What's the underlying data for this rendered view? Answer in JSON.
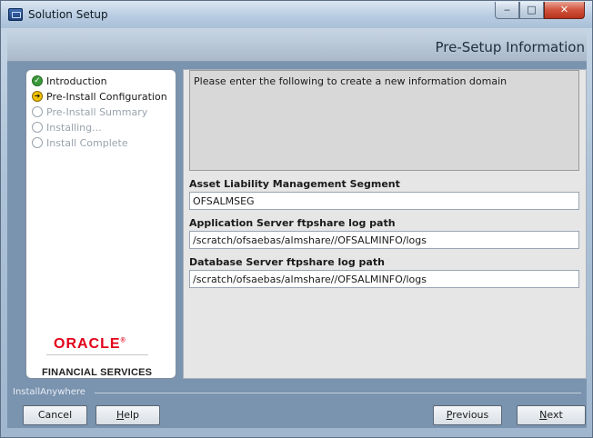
{
  "window": {
    "title": "Solution Setup",
    "minimize_glyph": "‒",
    "maximize_glyph": "□",
    "close_glyph": "✕"
  },
  "header": {
    "title": "Pre-Setup Information"
  },
  "steps": [
    {
      "label": "Introduction",
      "state": "done",
      "icon": "check-icon"
    },
    {
      "label": "Pre-Install Configuration",
      "state": "current",
      "icon": "arrow-right-icon"
    },
    {
      "label": "Pre-Install Summary",
      "state": "pending",
      "icon": "empty-circle-icon"
    },
    {
      "label": "Installing...",
      "state": "pending",
      "icon": "empty-circle-icon"
    },
    {
      "label": "Install Complete",
      "state": "pending",
      "icon": "empty-circle-icon"
    }
  ],
  "logo": {
    "brand": "ORACLE",
    "registered": "®",
    "subtitle": "FINANCIAL SERVICES"
  },
  "form": {
    "intro": "Please enter the following to create a new information domain",
    "fields": [
      {
        "label": "Asset Liability Management Segment",
        "value": "OFSALMSEG"
      },
      {
        "label": "Application Server ftpshare log path",
        "value": "/scratch/ofsaebas/almshare//OFSALMINFO/logs"
      },
      {
        "label": "Database Server ftpshare log path",
        "value": "/scratch/ofsaebas/almshare//OFSALMINFO/logs"
      }
    ]
  },
  "footer": {
    "vendor": "InstallAnywhere",
    "buttons": {
      "cancel": "Cancel",
      "help_first": "H",
      "help_rest": "elp",
      "previous_first": "P",
      "previous_rest": "revious",
      "next_first": "N",
      "next_rest": "ext"
    }
  },
  "colors": {
    "oracle_red": "#e2001a",
    "done_green": "#3a9a3a",
    "current_yellow": "#f2c200"
  }
}
